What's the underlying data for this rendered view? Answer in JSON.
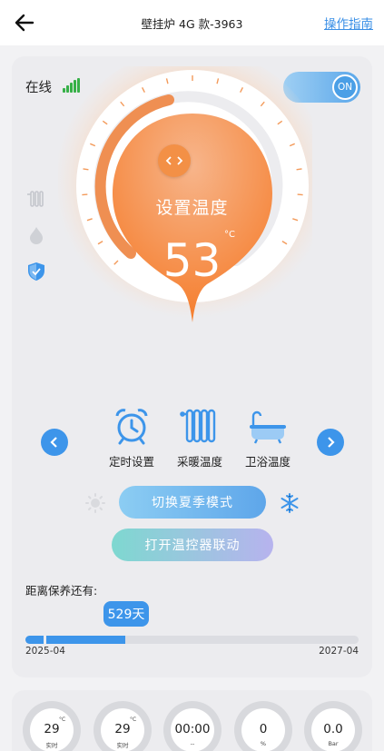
{
  "header": {
    "title": "壁挂炉 4G 款-3963",
    "guide_link": "操作指南",
    "back_icon": "arrow-left-icon"
  },
  "status": {
    "online_label": "在线",
    "signal_icon": "signal-bars-icon",
    "power_toggle_label": "ON"
  },
  "side_icons": [
    "radiator-icon",
    "flame-icon",
    "shield-check-icon"
  ],
  "dial": {
    "label": "设置温度",
    "value": "53",
    "unit": "°C",
    "handle_icon": "angle-brackets-icon"
  },
  "modes": [
    {
      "icon": "alarm-clock-icon",
      "label": "定时设置"
    },
    {
      "icon": "radiator-icon",
      "label": "采暖温度"
    },
    {
      "icon": "bathtub-icon",
      "label": "卫浴温度"
    }
  ],
  "nav": {
    "prev_icon": "chevron-left-icon",
    "next_icon": "chevron-right-icon"
  },
  "season": {
    "sun_icon": "sun-icon",
    "button_label": "切换夏季模式",
    "snow_icon": "snowflake-icon"
  },
  "thermostat_button_label": "打开温控器联动",
  "maintenance": {
    "label": "距离保养还有:",
    "days_badge": "529天",
    "progress_fraction": 0.3,
    "start_date": "2025-04",
    "end_date": "2027-04"
  },
  "gauges": [
    {
      "value": "29",
      "unit": "°C",
      "sub": "实时"
    },
    {
      "value": "29",
      "unit": "°C",
      "sub": "实时"
    },
    {
      "value": "00:00",
      "unit": "",
      "sub": "--"
    },
    {
      "value": "0",
      "unit": "",
      "sub": "%"
    },
    {
      "value": "0.0",
      "unit": "",
      "sub": "Bar"
    }
  ],
  "colors": {
    "accent_blue": "#3d95ea",
    "signal_green": "#36b047",
    "dial_orange": "#f58a3c"
  }
}
